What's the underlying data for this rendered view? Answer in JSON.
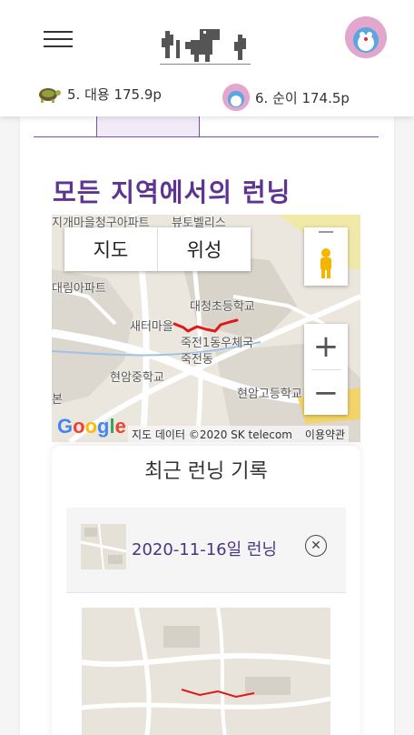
{
  "header": {
    "menu_icon": "hamburger-icon",
    "logo_icon": "dinosaur-cactus-logo",
    "profile_icon": "avatar"
  },
  "ranking": [
    {
      "label": "5. 대용 175.9p",
      "icon": "turtle-icon"
    },
    {
      "label": "6. 순이 174.5p",
      "icon": "avatar"
    }
  ],
  "section": {
    "title": "모든 지역에서의 런닝"
  },
  "map": {
    "type_buttons": [
      "지도",
      "위성"
    ],
    "zoom_in": "+",
    "zoom_out": "−",
    "attribution": "지도 데이터 ©2020 SK telecom",
    "terms": "이용약관",
    "google": "Google",
    "places": [
      "지개마을청구아파트",
      "뷰토벨리스",
      "대림아파트",
      "대청초등학교",
      "새터마을",
      "죽전1동우체국",
      "죽전동",
      "현암중학교",
      "현암고등학교",
      "본"
    ]
  },
  "recent": {
    "title": "최근 런닝 기록",
    "records": [
      {
        "label": "2020-11-16일 런닝"
      }
    ]
  },
  "colors": {
    "accent": "#5d3591",
    "route": "#e01818"
  }
}
